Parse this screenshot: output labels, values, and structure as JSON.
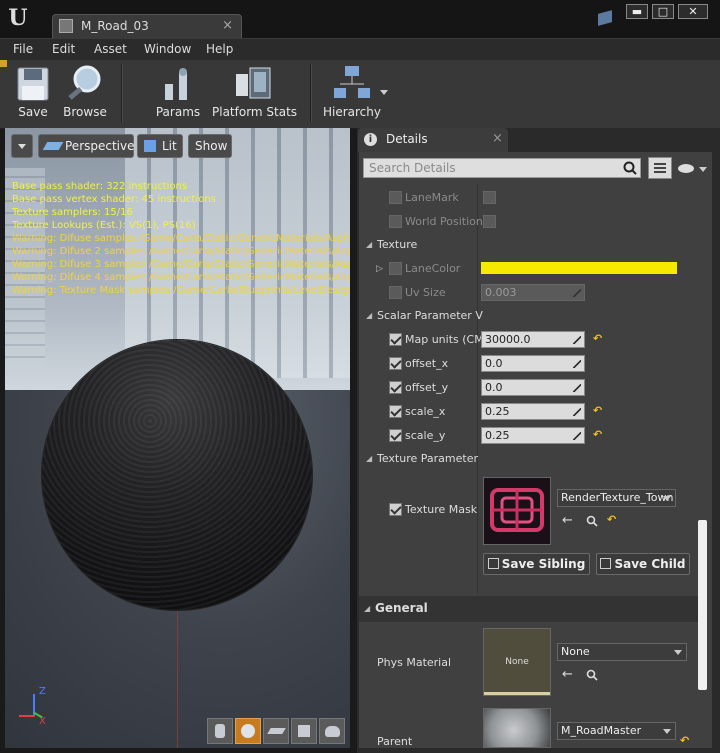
{
  "window": {
    "doc_tab": "M_Road_03",
    "tab_close": "×",
    "minimize": "▬",
    "maximize": "□",
    "close": "✕"
  },
  "menu": [
    "File",
    "Edit",
    "Asset",
    "Window",
    "Help"
  ],
  "toolbar": {
    "save": "Save",
    "browse": "Browse",
    "params": "Params",
    "platform_stats": "Platform Stats",
    "hierarchy": "Hierarchy"
  },
  "viewport": {
    "perspective": "Perspective",
    "lit": "Lit",
    "show": "Show",
    "stats": [
      "Base pass shader: 322 instructions",
      "Base pass vertex shader: 45 instructions",
      "Texture samplers: 15/16",
      "Texture Lookups (Est.): VS(1), PS(16)",
      "Warning: Difuse samples /Game/Carla/Static/GenericMaterials/Asph",
      "Warning: Difuse 2 samples /Game/Carla/Static/GenericMaterials/Asp",
      "Warning: Difuse 3 samples /Game/Carla/Static/GenericMaterials/Asp",
      "Warning: Difuse 4 samples /Game/Carla/Static/GenericMaterials/Asp",
      "Warning: Texture Mask samples /Game/Carla/Blueprints/LevelDesign"
    ],
    "axis_z": "Z",
    "axis_x": "X"
  },
  "details": {
    "tab_label": "Details",
    "tab_close": "×",
    "search_placeholder": "Search Details",
    "lanemark": "LaneMark",
    "world_position": "World Position",
    "texture_cat": "Texture",
    "lanecolor": "LaneColor",
    "uv_size": "Uv Size",
    "uv_size_value": "0.003",
    "scalar_cat": "Scalar Parameter V",
    "map_units": "Map units (CM",
    "map_units_value": "30000.0",
    "offset_x": "offset_x",
    "offset_x_value": "0.0",
    "offset_y": "offset_y",
    "offset_y_value": "0.0",
    "scale_x": "scale_x",
    "scale_x_value": "0.25",
    "scale_y": "scale_y",
    "scale_y_value": "0.25",
    "texparam_cat": "Texture Parameter",
    "texture_mask": "Texture Mask",
    "texture_mask_value": "RenderTexture_Town",
    "save_sibling": "Save Sibling",
    "save_child": "Save Child",
    "general_cat": "General",
    "phys_material": "Phys Material",
    "phys_material_thumb": "None",
    "phys_material_value": "None",
    "parent": "Parent",
    "parent_value": "M_RoadMaster",
    "reset_glyph": "↶"
  },
  "colors": {
    "lanecolor": "#f5ea00",
    "stats_text": "#f2f23a",
    "accent_orange": "#c87a1e"
  }
}
